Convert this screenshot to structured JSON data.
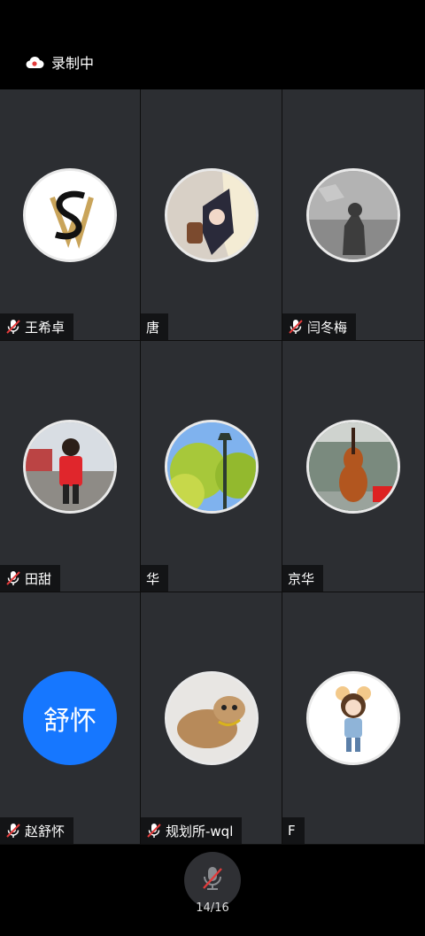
{
  "status": {
    "recording_label": "录制中"
  },
  "participants": [
    {
      "name": "王希卓",
      "muted": true,
      "avatar": "logo-sw"
    },
    {
      "name": "唐",
      "muted": false,
      "avatar": "anime-girl"
    },
    {
      "name": "闫冬梅",
      "muted": true,
      "avatar": "bw-photo"
    },
    {
      "name": "田甜",
      "muted": true,
      "avatar": "boy-red-shirt"
    },
    {
      "name": "华",
      "muted": false,
      "avatar": "tree-lamp"
    },
    {
      "name": "京华",
      "muted": false,
      "avatar": "cello"
    },
    {
      "name": "赵舒怀",
      "muted": true,
      "avatar_text": "舒怀"
    },
    {
      "name": "规划所-wql",
      "muted": true,
      "avatar": "cat"
    },
    {
      "name": "F",
      "muted": false,
      "avatar": "doll"
    }
  ],
  "controls": {
    "mic_state": "muted"
  },
  "pager": {
    "label": "14/16"
  },
  "colors": {
    "initials_bg": "#1677ff",
    "tile_bg": "#2c2e32"
  }
}
